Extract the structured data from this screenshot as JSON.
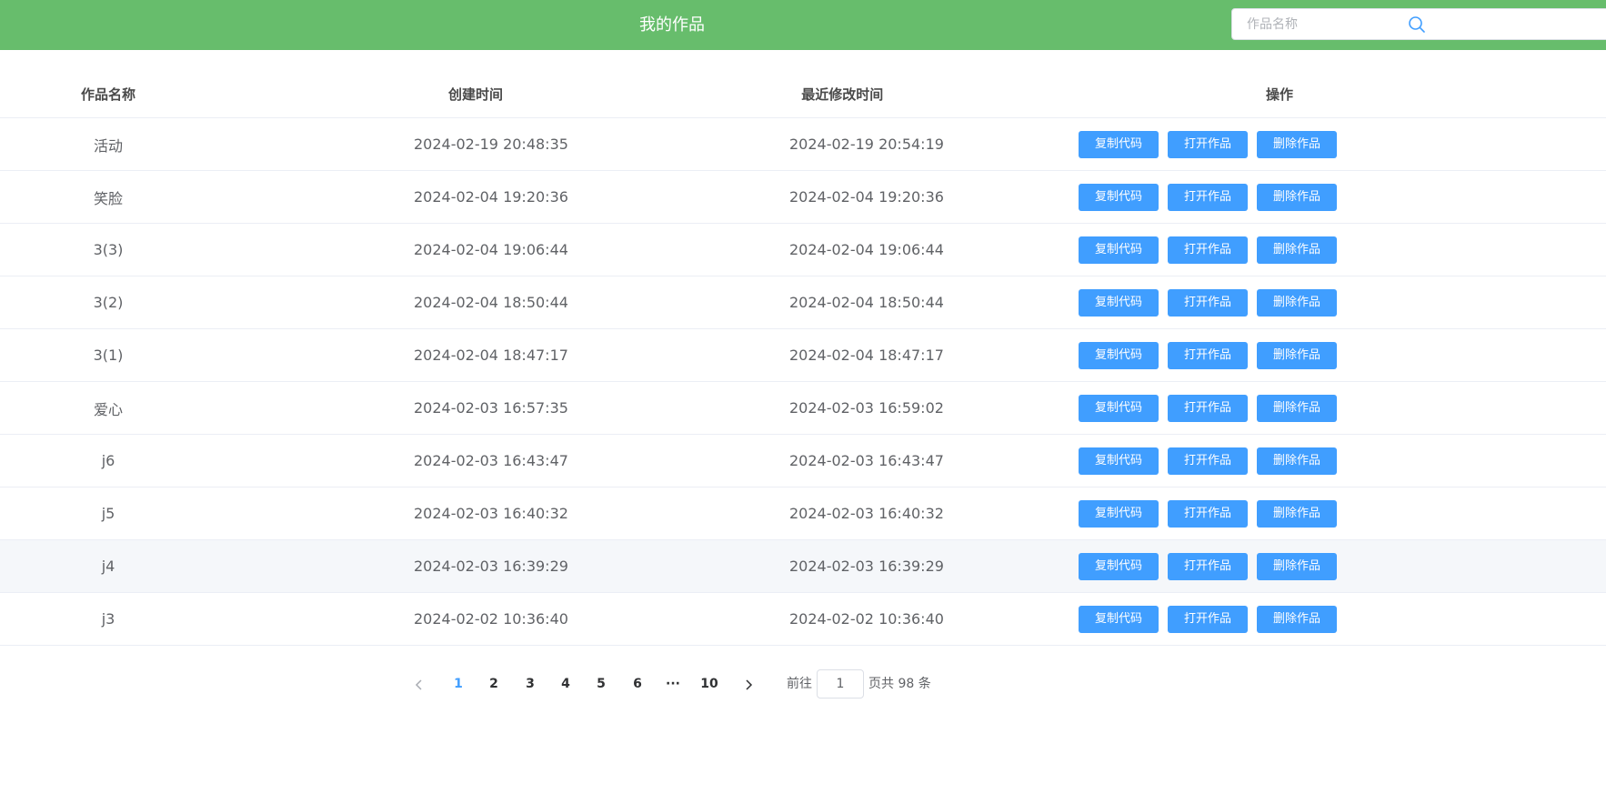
{
  "header": {
    "title": "我的作品",
    "search_placeholder": "作品名称",
    "search_value": ""
  },
  "table": {
    "headers": [
      "作品名称",
      "创建时间",
      "最近修改时间",
      "操作"
    ],
    "rows": [
      {
        "name": "活动",
        "created": "2024-02-19 20:48:35",
        "modified": "2024-02-19 20:54:19"
      },
      {
        "name": "笑脸",
        "created": "2024-02-04 19:20:36",
        "modified": "2024-02-04 19:20:36"
      },
      {
        "name": "3(3)",
        "created": "2024-02-04 19:06:44",
        "modified": "2024-02-04 19:06:44"
      },
      {
        "name": "3(2)",
        "created": "2024-02-04 18:50:44",
        "modified": "2024-02-04 18:50:44"
      },
      {
        "name": "3(1)",
        "created": "2024-02-04 18:47:17",
        "modified": "2024-02-04 18:47:17"
      },
      {
        "name": "爱心",
        "created": "2024-02-03 16:57:35",
        "modified": "2024-02-03 16:59:02"
      },
      {
        "name": "j6",
        "created": "2024-02-03 16:43:47",
        "modified": "2024-02-03 16:43:47"
      },
      {
        "name": "j5",
        "created": "2024-02-03 16:40:32",
        "modified": "2024-02-03 16:40:32"
      },
      {
        "name": "j4",
        "created": "2024-02-03 16:39:29",
        "modified": "2024-02-03 16:39:29"
      },
      {
        "name": "j3",
        "created": "2024-02-02 10:36:40",
        "modified": "2024-02-02 10:36:40"
      }
    ],
    "actions": {
      "copy": "复制代码",
      "open": "打开作品",
      "delete": "删除作品"
    },
    "hovered_row_index": 8
  },
  "pagination": {
    "prev_icon": "chevron-left-icon",
    "next_icon": "chevron-right-icon",
    "pages": [
      "1",
      "2",
      "3",
      "4",
      "5",
      "6"
    ],
    "ellipsis": "···",
    "last_page": "10",
    "current_page": "1",
    "goto_label": "前往",
    "goto_value": "1",
    "total_text": "页共 98 条"
  },
  "colors": {
    "header_bg": "#67bd6c",
    "primary": "#409eff",
    "active_page": "#409eff"
  }
}
